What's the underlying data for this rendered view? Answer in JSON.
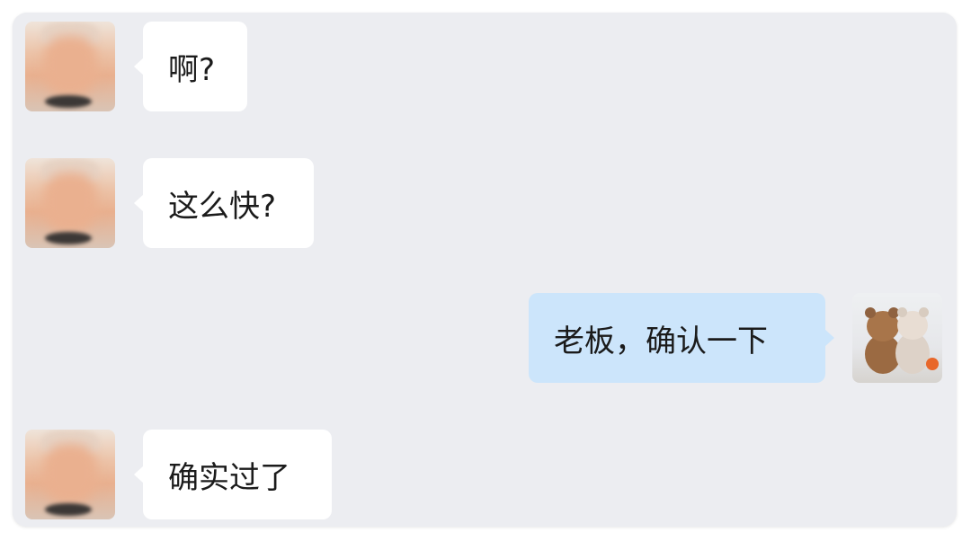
{
  "chat": {
    "background_color": "#ecedf1",
    "incoming_bubble_color": "#ffffff",
    "outgoing_bubble_color": "#cce5fb",
    "messages": [
      {
        "sender": "other",
        "text": "啊?",
        "avatar": "blurred-person-avatar"
      },
      {
        "sender": "other",
        "text": "这么快?",
        "avatar": "blurred-person-avatar"
      },
      {
        "sender": "self",
        "text": "老板，确认一下",
        "avatar": "teddy-bears-avatar"
      },
      {
        "sender": "other",
        "text": "确实过了",
        "avatar": "blurred-person-avatar"
      }
    ]
  }
}
